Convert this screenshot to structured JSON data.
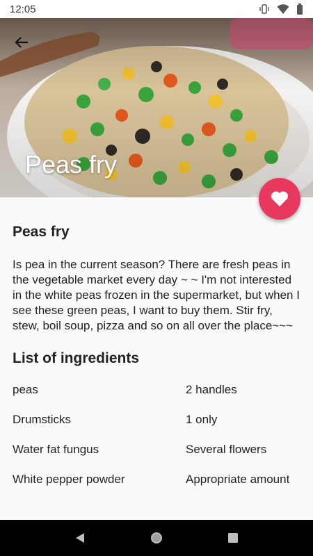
{
  "status_bar": {
    "time": "12:05",
    "icons": [
      "vibrate-icon",
      "wifi-icon",
      "battery-icon"
    ]
  },
  "header": {
    "back_icon": "arrow-back-icon",
    "hero_title": "Peas fry",
    "favorite_icon": "heart-icon",
    "accent_color": "#e8385e"
  },
  "recipe": {
    "title": "Peas fry",
    "description": "Is pea in the current season? There are fresh peas in the vegetable market every day ~ ~ I'm not interested in the white peas frozen in the supermarket, but when I see these green peas, I want to buy them. Stir fry, stew, boil soup, pizza and so on all over the place~~~",
    "ingredients_heading": "List of ingredients",
    "ingredients": [
      {
        "name": "peas",
        "amount": "2 handles"
      },
      {
        "name": "Drumsticks",
        "amount": "1 only"
      },
      {
        "name": "Water fat fungus",
        "amount": "Several flowers"
      },
      {
        "name": "White pepper powder",
        "amount": "Appropriate amount"
      }
    ]
  },
  "nav_bar": {
    "icons": [
      "nav-back-icon",
      "nav-home-icon",
      "nav-recents-icon"
    ]
  }
}
